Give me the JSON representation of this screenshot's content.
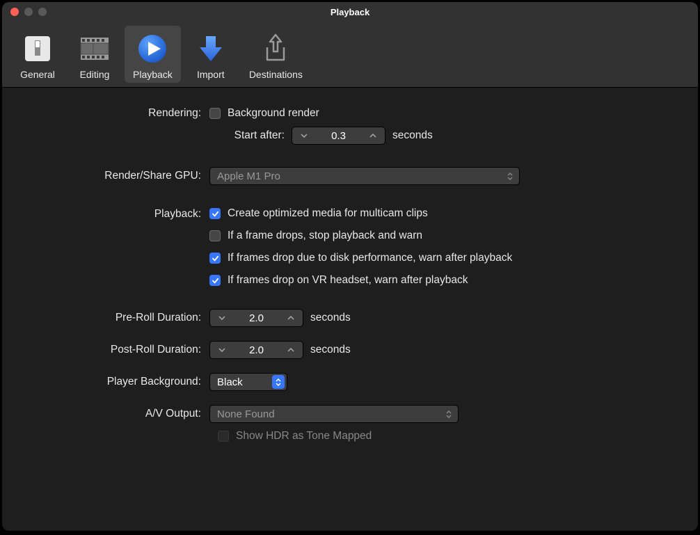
{
  "window": {
    "title": "Playback"
  },
  "toolbar": {
    "items": [
      {
        "label": "General"
      },
      {
        "label": "Editing"
      },
      {
        "label": "Playback"
      },
      {
        "label": "Import"
      },
      {
        "label": "Destinations"
      }
    ]
  },
  "form": {
    "rendering": {
      "label": "Rendering:",
      "background_render": "Background render",
      "start_after_label": "Start after:",
      "start_after_value": "0.3",
      "seconds": "seconds"
    },
    "gpu": {
      "label": "Render/Share GPU:",
      "value": "Apple M1 Pro"
    },
    "playback": {
      "label": "Playback:",
      "opt1": "Create optimized media for multicam clips",
      "opt2": "If a frame drops, stop playback and warn",
      "opt3": "If frames drop due to disk performance, warn after playback",
      "opt4": "If frames drop on VR headset, warn after playback"
    },
    "preroll": {
      "label": "Pre-Roll Duration:",
      "value": "2.0",
      "unit": "seconds"
    },
    "postroll": {
      "label": "Post-Roll Duration:",
      "value": "2.0",
      "unit": "seconds"
    },
    "player_bg": {
      "label": "Player Background:",
      "value": "Black"
    },
    "av_output": {
      "label": "A/V Output:",
      "value": "None Found",
      "hdr": "Show HDR as Tone Mapped"
    }
  }
}
